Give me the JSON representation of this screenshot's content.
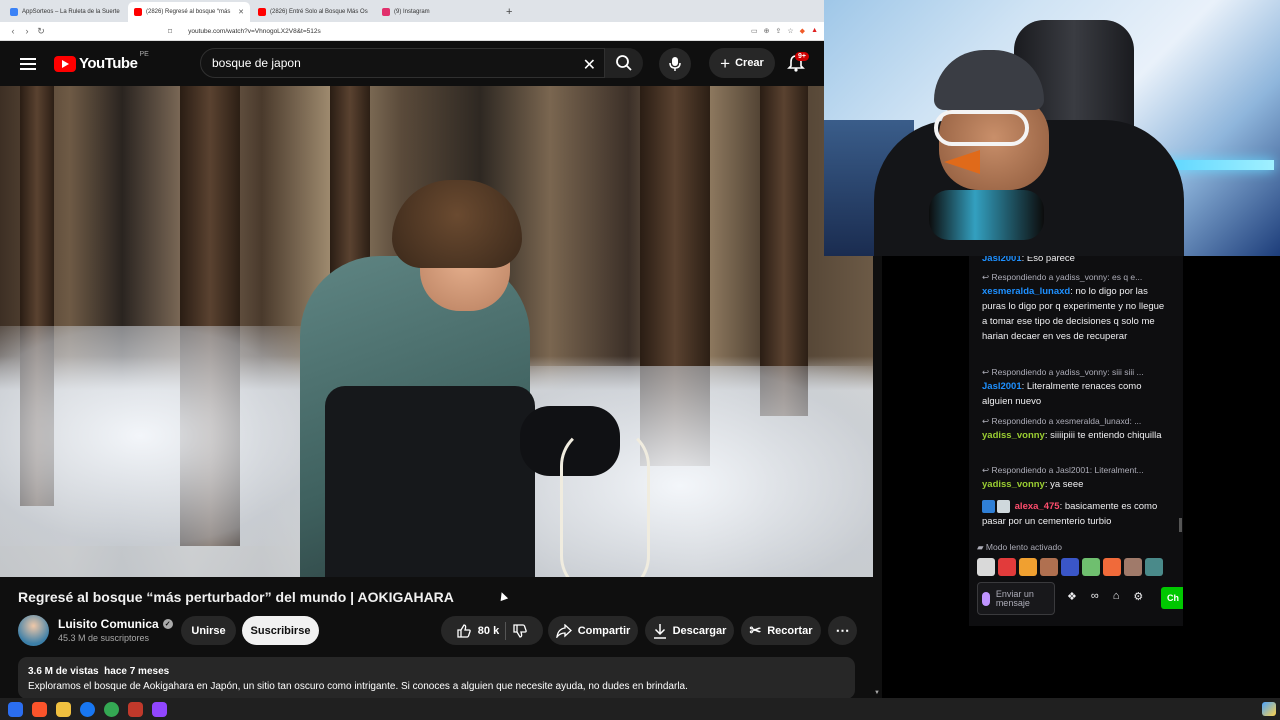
{
  "browser": {
    "tabs": [
      {
        "label": "AppSorteos – La Ruleta de la Suerte",
        "color": "#3b82f6",
        "active": false
      },
      {
        "label": "(2826) Regresé al bosque “más",
        "color": "#ff0000",
        "active": true
      },
      {
        "label": "(2826) Entré Solo al Bosque Más Os",
        "color": "#ff0000",
        "active": false
      },
      {
        "label": "(9) Instagram",
        "color": "#e1306c",
        "active": false
      }
    ],
    "new_tab": "+",
    "url": "youtube.com/watch?v=VhnogoLX2V8&t=512s"
  },
  "youtube": {
    "logo": "YouTube",
    "country": "PE",
    "search_value": "bosque de japon",
    "create_label": "Crear",
    "notif_count": "9+",
    "video_title": "Regresé al bosque “más perturbador” del mundo | AOKIGAHARA",
    "channel_name": "Luisito Comunica",
    "subscribers": "45.3 M de suscriptores",
    "join_label": "Unirse",
    "subscribe_label": "Suscribirse",
    "likes": "80 k",
    "share_label": "Compartir",
    "download_label": "Descargar",
    "clip_label": "Recortar",
    "views_line": "3.6 M de vistas  hace 7 meses",
    "description": "Exploramos el bosque de Aokigahara en Japón, un sitio tan oscuro como intrigante. Si conoces a alguien que necesite ayuda, no dudes en brindarla."
  },
  "chat": {
    "m1_user": "Jasl2001",
    "m1_text": ": Eso parece",
    "r1": "Respondiendo a yadiss_vonny: es q e...",
    "m2_user": "xesmeralda_lunaxd",
    "m2_text": ": no lo digo por las puras lo digo por q experimente y no llegue a tomar ese tipo de decisiones q solo me harian decaer en ves de recuperar",
    "r2": "Respondiendo a yadiss_vonny: siii siii ...",
    "m3_user": "Jasl2001",
    "m3_text": ": Literalmente renaces como alguien nuevo",
    "r3": "Respondiendo a xesmeralda_lunaxd: ...",
    "m4_user": "yadiss_vonny",
    "m4_text": ": siiiipiii te entiendo chiquilla",
    "r4": "Respondiendo a Jasl2001: Literalment...",
    "m5_user": "yadiss_vonny",
    "m5_text": ": ya seee",
    "m6_user": "alexa_475",
    "m6_text": ": basicamente es como pasar por un cementerio turbio",
    "slow_mode": "Modo lento activado",
    "input_placeholder": "Enviar un mensaje",
    "send_label": "Ch"
  },
  "colors": {
    "yt_red": "#ff0000",
    "twitch_purple": "#bf94ff",
    "chat_send_green": "#00c800"
  }
}
